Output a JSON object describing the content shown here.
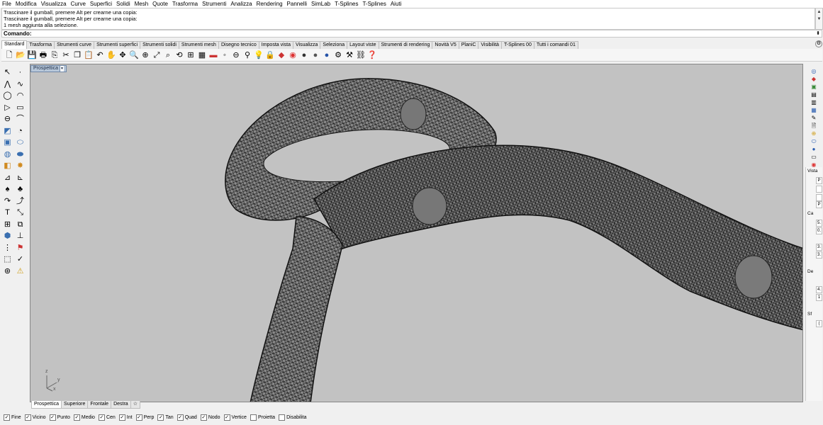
{
  "menu": [
    "File",
    "Modifica",
    "Visualizza",
    "Curve",
    "Superfici",
    "Solidi",
    "Mesh",
    "Quote",
    "Trasforma",
    "Strumenti",
    "Analizza",
    "Rendering",
    "Pannelli",
    "SimLab",
    "T-Splines",
    "T-Splines",
    "Aiuti"
  ],
  "history": {
    "line1": "Trascinare il gumball, premere Alt per crearne una copia:",
    "line2": "Trascinare il gumball, premere Alt per crearne una copia:",
    "line3": "1 mesh aggiunta alla selezione."
  },
  "command": {
    "label": "Comando:"
  },
  "toolbar_tabs": [
    "Standard",
    "Trasforma",
    "Strumenti curve",
    "Strumenti superfici",
    "Strumenti solidi",
    "Strumenti mesh",
    "Disegno tecnico",
    "Imposta vista",
    "Visualizza",
    "Seleziona",
    "Layout viste",
    "Strumenti di rendering",
    "Novità V5",
    "PlaniC",
    "Visibilità",
    "T-Splines 00",
    "Tutti i comandi 01"
  ],
  "viewport": {
    "title": "Prospettica",
    "axes": {
      "z": "z",
      "y": "y",
      "x": "x"
    }
  },
  "viewport_tabs": [
    "Prospettica",
    "Superiore",
    "Frontale",
    "Destra"
  ],
  "viewport_tab_add": "☆",
  "right_panel": {
    "header": "Vista",
    "rows": [
      {
        "label": "",
        "value": "P"
      },
      {
        "label": "",
        "value": "P"
      },
      {
        "label": "Ca",
        "value": ""
      },
      {
        "label": "",
        "value": "5."
      },
      {
        "label": "",
        "value": "0."
      },
      {
        "label": "",
        "value": "3."
      },
      {
        "label": "",
        "value": "3."
      },
      {
        "label": "De",
        "value": ""
      },
      {
        "label": "",
        "value": "4."
      },
      {
        "label": "",
        "value": "1"
      },
      {
        "label": "Sf",
        "value": ""
      },
      {
        "label": "",
        "value": "("
      }
    ]
  },
  "osnaps": [
    {
      "label": "Fine",
      "checked": true
    },
    {
      "label": "Vicino",
      "checked": true
    },
    {
      "label": "Punto",
      "checked": true
    },
    {
      "label": "Medio",
      "checked": true
    },
    {
      "label": "Cen",
      "checked": true
    },
    {
      "label": "Int",
      "checked": true
    },
    {
      "label": "Perp",
      "checked": true
    },
    {
      "label": "Tan",
      "checked": true
    },
    {
      "label": "Quad",
      "checked": true
    },
    {
      "label": "Nodo",
      "checked": true
    },
    {
      "label": "Vertice",
      "checked": true
    },
    {
      "label": "Proietta",
      "checked": false
    },
    {
      "label": "Disabilita",
      "checked": false
    }
  ]
}
